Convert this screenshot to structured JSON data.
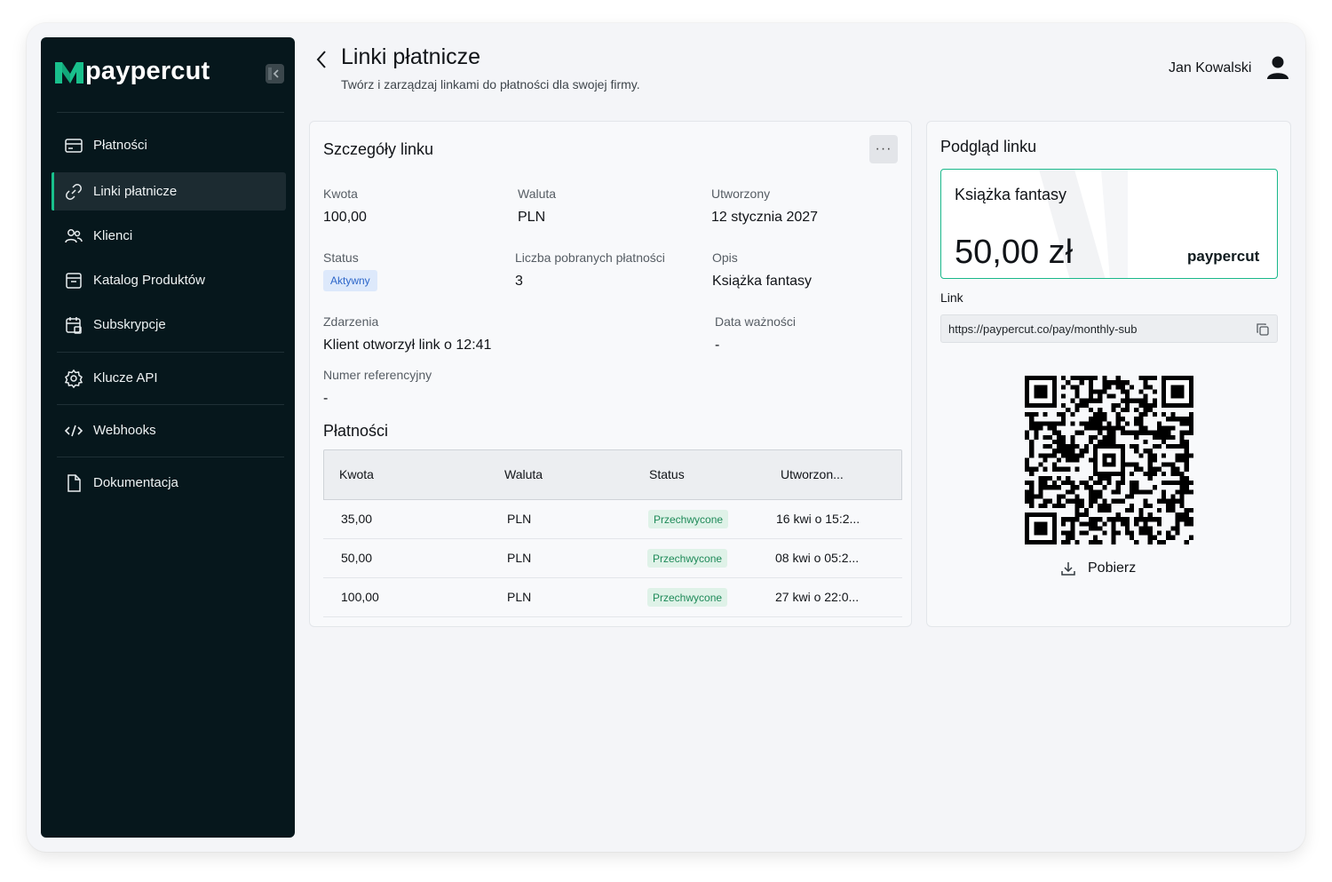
{
  "brand": {
    "name": "paypercut",
    "accent": "#19c08c"
  },
  "sidebar": {
    "items": [
      {
        "label": "Płatności",
        "icon": "card-icon",
        "active": false
      },
      {
        "label": "Linki płatnicze",
        "icon": "link-icon",
        "active": true
      },
      {
        "label": "Klienci",
        "icon": "users-icon",
        "active": false
      },
      {
        "label": "Katalog Produktów",
        "icon": "archive-icon",
        "active": false
      },
      {
        "label": "Subskrypcje",
        "icon": "calendar-icon",
        "active": false
      },
      {
        "label": "Klucze API",
        "icon": "gear-icon",
        "active": false
      },
      {
        "label": "Webhooks",
        "icon": "code-icon",
        "active": false
      },
      {
        "label": "Dokumentacja",
        "icon": "document-icon",
        "active": false
      }
    ]
  },
  "header": {
    "title": "Linki płatnicze",
    "subtitle": "Twórz i zarządzaj linkami do płatności dla swojej firmy.",
    "user_name": "Jan Kowalski"
  },
  "details": {
    "title": "Szczegóły linku",
    "more_label": "···",
    "fields": {
      "amount": {
        "label": "Kwota",
        "value": "100,00"
      },
      "currency": {
        "label": "Waluta",
        "value": "PLN"
      },
      "created": {
        "label": "Utworzony",
        "value": "12 stycznia 2027"
      },
      "status": {
        "label": "Status",
        "value": "Aktywny"
      },
      "collected": {
        "label": "Liczba pobranych płatności",
        "value": "3"
      },
      "description": {
        "label": "Opis",
        "value": "Książka fantasy"
      },
      "events": {
        "label": "Zdarzenia",
        "value": "Klient otworzył link o 12:41"
      },
      "expiry": {
        "label": "Data ważności",
        "value": "-"
      },
      "reference": {
        "label": "Numer referencyjny",
        "value": "-"
      }
    }
  },
  "payments": {
    "title": "Płatności",
    "columns": [
      "Kwota",
      "Waluta",
      "Status",
      "Utworzon..."
    ],
    "rows": [
      {
        "amount": "35,00",
        "currency": "PLN",
        "status": "Przechwycone",
        "created": "16 kwi o 15:2..."
      },
      {
        "amount": "50,00",
        "currency": "PLN",
        "status": "Przechwycone",
        "created": "08 kwi o 05:2..."
      },
      {
        "amount": "100,00",
        "currency": "PLN",
        "status": "Przechwycone",
        "created": "27 kwi o 22:0..."
      }
    ]
  },
  "preview": {
    "title": "Podgląd linku",
    "product": "Książka fantasy",
    "amount": "50,00 zł",
    "brand": "paypercut",
    "link_label": "Link",
    "link_url": "https://paypercut.co/pay/monthly-sub",
    "download_label": "Pobierz"
  }
}
